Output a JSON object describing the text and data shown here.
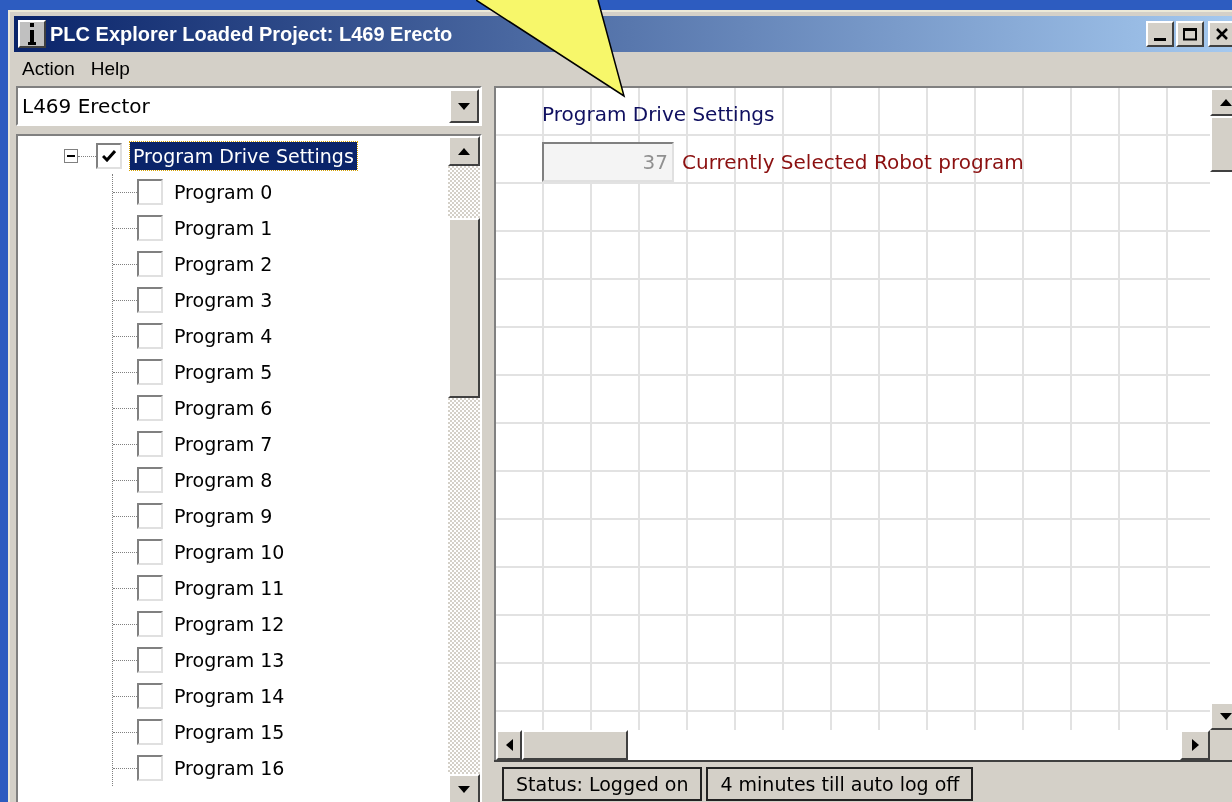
{
  "window": {
    "title": "PLC Explorer Loaded Project: L469 Erecto"
  },
  "menu": [
    "Action",
    "Help"
  ],
  "project_select": {
    "value": "L469 Erector"
  },
  "tree": [
    {
      "label": "Program Drive Settings",
      "checked": true,
      "selected": true,
      "expanded": true,
      "children": [
        {
          "label": "Program 0",
          "checked": false,
          "selected": false
        },
        {
          "label": "Program 1",
          "checked": false,
          "selected": false
        },
        {
          "label": "Program 2",
          "checked": false,
          "selected": false
        },
        {
          "label": "Program 3",
          "checked": false,
          "selected": false
        },
        {
          "label": "Program 4",
          "checked": false,
          "selected": false
        },
        {
          "label": "Program 5",
          "checked": false,
          "selected": false
        },
        {
          "label": "Program 6",
          "checked": false,
          "selected": false
        },
        {
          "label": "Program 7",
          "checked": false,
          "selected": false
        },
        {
          "label": "Program 8",
          "checked": false,
          "selected": false
        },
        {
          "label": "Program 9",
          "checked": false,
          "selected": false
        },
        {
          "label": "Program 10",
          "checked": false,
          "selected": false
        },
        {
          "label": "Program 11",
          "checked": false,
          "selected": false
        },
        {
          "label": "Program 12",
          "checked": false,
          "selected": false
        },
        {
          "label": "Program 13",
          "checked": false,
          "selected": false
        },
        {
          "label": "Program 14",
          "checked": false,
          "selected": false
        },
        {
          "label": "Program 15",
          "checked": false,
          "selected": false
        },
        {
          "label": "Program 16",
          "checked": false,
          "selected": false
        }
      ]
    }
  ],
  "panel": {
    "heading": "Program Drive Settings",
    "field": {
      "value": "37",
      "label": "Currently Selected Robot program"
    }
  },
  "status_bar": [
    "Status: Logged on",
    "4 minutes till auto log off"
  ]
}
